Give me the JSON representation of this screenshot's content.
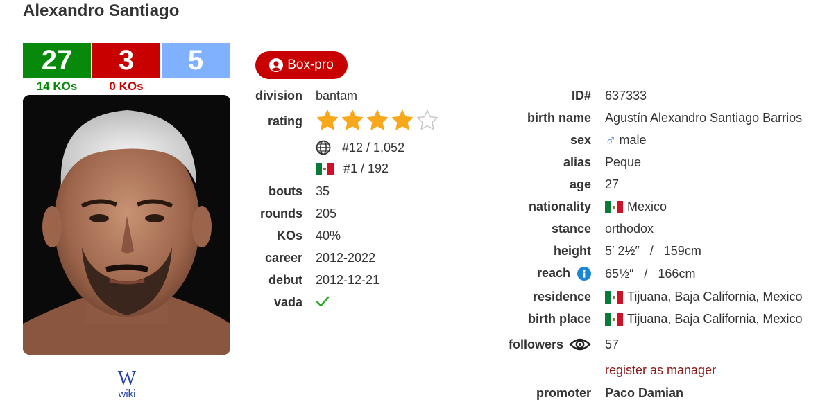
{
  "boxer": {
    "name": "Alexandro Santiago"
  },
  "record": {
    "wins": "27",
    "losses": "3",
    "draws": "5",
    "wins_ko": "14 KOs",
    "losses_ko": "0 KOs"
  },
  "colors": {
    "wins": "#078a0c",
    "losses": "#c80000",
    "draws": "#7fb1ff",
    "badge": "#c80000",
    "register_link": "#8b1a1a"
  },
  "wiki": {
    "glyph": "W",
    "label": "wiki"
  },
  "badge": {
    "label": "Box-pro",
    "icon": "user-circle-icon"
  },
  "left": {
    "division": {
      "label": "division",
      "value": "bantam"
    },
    "rating": {
      "label": "rating",
      "stars": 4,
      "max_stars": 5,
      "world_rank": "#12 / 1,052",
      "national_rank": "#1 / 192",
      "world_icon": "globe-icon",
      "national_icon": "mexico-flag-icon"
    },
    "bouts": {
      "label": "bouts",
      "value": "35"
    },
    "rounds": {
      "label": "rounds",
      "value": "205"
    },
    "kos": {
      "label": "KOs",
      "value": "40%"
    },
    "career": {
      "label": "career",
      "value": "2012-2022"
    },
    "debut": {
      "label": "debut",
      "value": "2012-12-21"
    },
    "vada": {
      "label": "vada",
      "icon": "check-icon"
    }
  },
  "right": {
    "id": {
      "label": "ID#",
      "value": "637333"
    },
    "birth_name": {
      "label": "birth name",
      "value": "Agustín Alexandro Santiago Barrios"
    },
    "sex": {
      "label": "sex",
      "symbol": "♂",
      "value": "male"
    },
    "alias": {
      "label": "alias",
      "value": "Peque"
    },
    "age": {
      "label": "age",
      "value": "27"
    },
    "nationality": {
      "label": "nationality",
      "value": "Mexico"
    },
    "stance": {
      "label": "stance",
      "value": "orthodox"
    },
    "height": {
      "label": "height",
      "value": "5′ 2½″   /   159cm"
    },
    "reach": {
      "label": "reach",
      "value": "65½″   /   166cm",
      "info_icon": "info-icon"
    },
    "residence": {
      "label": "residence",
      "value": "Tijuana, Baja California, Mexico"
    },
    "birth_place": {
      "label": "birth place",
      "value": "Tijuana, Baja California, Mexico"
    },
    "followers": {
      "label": "followers",
      "value": "57",
      "icon": "eye-icon"
    },
    "register": {
      "label": "register as manager"
    },
    "promoter": {
      "label": "promoter",
      "value": "Paco Damian"
    }
  }
}
